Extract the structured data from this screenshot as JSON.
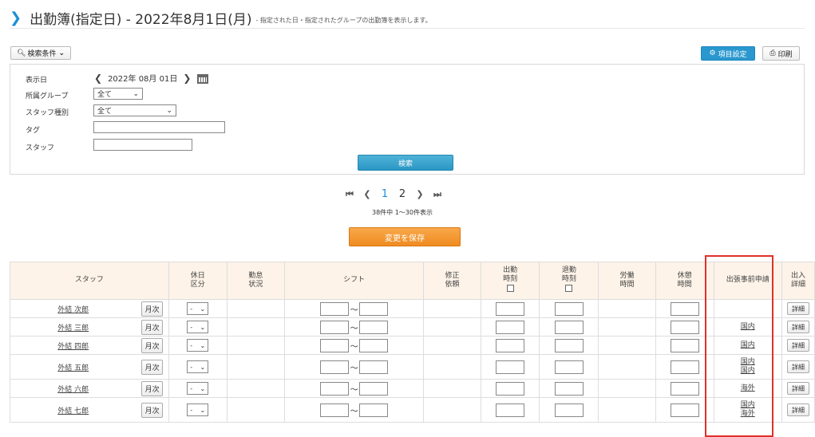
{
  "header": {
    "title": "出勤簿(指定日) - 2022年8月1日(月)",
    "subtitle": "- 指定された日・指定されたグループの出勤簿を表示します。"
  },
  "toolbar": {
    "search_conditions_label": "検索条件",
    "item_settings_label": "項目設定",
    "print_label": "印刷"
  },
  "filters": {
    "display_date_label": "表示日",
    "display_date_value": "2022年 08月 01日",
    "group_label": "所属グループ",
    "group_value": "全て",
    "staff_type_label": "スタッフ種別",
    "staff_type_value": "全て",
    "tag_label": "タグ",
    "tag_value": "",
    "staff_label": "スタッフ",
    "staff_value": "",
    "search_button": "検索"
  },
  "pagination": {
    "pages": [
      "1",
      "2"
    ],
    "current": "1",
    "range_text": "38件中 1〜30件表示"
  },
  "save_button": "変更を保存",
  "table": {
    "headers": {
      "staff": "スタッフ",
      "holiday_1": "休日",
      "holiday_2": "区分",
      "attendance_1": "勤怠",
      "attendance_2": "状況",
      "shift": "シフト",
      "correction_1": "修正",
      "correction_2": "依頼",
      "clock_in_1": "出勤",
      "clock_in_2": "時刻",
      "clock_out_1": "退勤",
      "clock_out_2": "時刻",
      "work_1": "労働",
      "work_2": "時間",
      "break_1": "休憩",
      "break_2": "時間",
      "business_trip": "出張事前申請",
      "io_detail_1": "出入",
      "io_detail_2": "詳細"
    },
    "monthly_label": "月次",
    "detail_label": "詳細",
    "holiday_select_value": "-",
    "shift_separator": "〜",
    "rows": [
      {
        "name": "外結 次郎",
        "trips": []
      },
      {
        "name": "外結 三郎",
        "trips": [
          "国内"
        ]
      },
      {
        "name": "外結 四郎",
        "trips": [
          "国内"
        ]
      },
      {
        "name": "外結 五郎",
        "trips": [
          "国内",
          "国内"
        ]
      },
      {
        "name": "外結 六郎",
        "trips": [
          "海外"
        ]
      },
      {
        "name": "外結 七郎",
        "trips": [
          "国内",
          "海外"
        ]
      }
    ]
  },
  "colors": {
    "accent_blue": "#1a8fd6",
    "save_orange": "#ef8b21",
    "highlight_red": "#e0302a",
    "header_bg": "#fdf3e8"
  }
}
